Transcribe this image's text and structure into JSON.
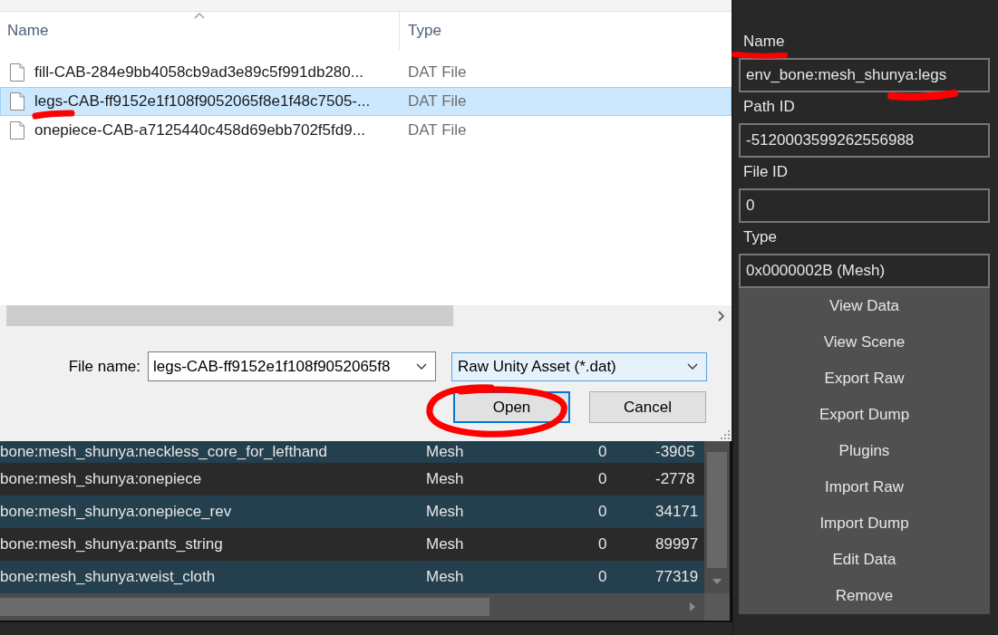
{
  "file_dialog": {
    "columns": [
      {
        "label": "Name",
        "sorted": true
      },
      {
        "label": "Type",
        "sorted": false
      }
    ],
    "files": [
      {
        "name": "fill-CAB-284e9bb4058cb9ad3e89c5f991db280...",
        "type": "DAT File",
        "selected": false
      },
      {
        "name": "legs-CAB-ff9152e1f108f9052065f8e1f48c7505-...",
        "type": "DAT File",
        "selected": true
      },
      {
        "name": "onepiece-CAB-a7125440c458d69ebb702f5fd9...",
        "type": "DAT File",
        "selected": false
      }
    ],
    "file_name_label": "File name:",
    "file_name": "legs-CAB-ff9152e1f108f9052065f8",
    "file_type": "Raw Unity Asset (*.dat)",
    "buttons": [
      {
        "label": "Open",
        "default": true
      },
      {
        "label": "Cancel",
        "default": false
      }
    ]
  },
  "asset_table": {
    "rows": [
      {
        "cells": [
          "bone:mesh_shunya:neckless_core_for_lefthand",
          "Mesh",
          "0",
          "-3905"
        ]
      },
      {
        "cells": [
          "bone:mesh_shunya:onepiece",
          "Mesh",
          "0",
          "-2778"
        ]
      },
      {
        "cells": [
          "bone:mesh_shunya:onepiece_rev",
          "Mesh",
          "0",
          "34171"
        ]
      },
      {
        "cells": [
          "bone:mesh_shunya:pants_string",
          "Mesh",
          "0",
          "89997"
        ]
      },
      {
        "cells": [
          "bone:mesh_shunya:weist_cloth",
          "Mesh",
          "0",
          "77319"
        ]
      }
    ]
  },
  "inspector": {
    "fields": [
      {
        "label": "Name",
        "value": "env_bone:mesh_shunya:legs"
      },
      {
        "label": "Path ID",
        "value": "-5120003599262556988"
      },
      {
        "label": "File ID",
        "value": "0"
      },
      {
        "label": "Type",
        "value": "0x0000002B (Mesh)"
      }
    ],
    "buttons": [
      "View Data",
      "View Scene",
      "Export Raw",
      "Export Dump",
      "Plugins",
      "Import Raw",
      "Import Dump",
      "Edit Data",
      "Remove"
    ]
  }
}
